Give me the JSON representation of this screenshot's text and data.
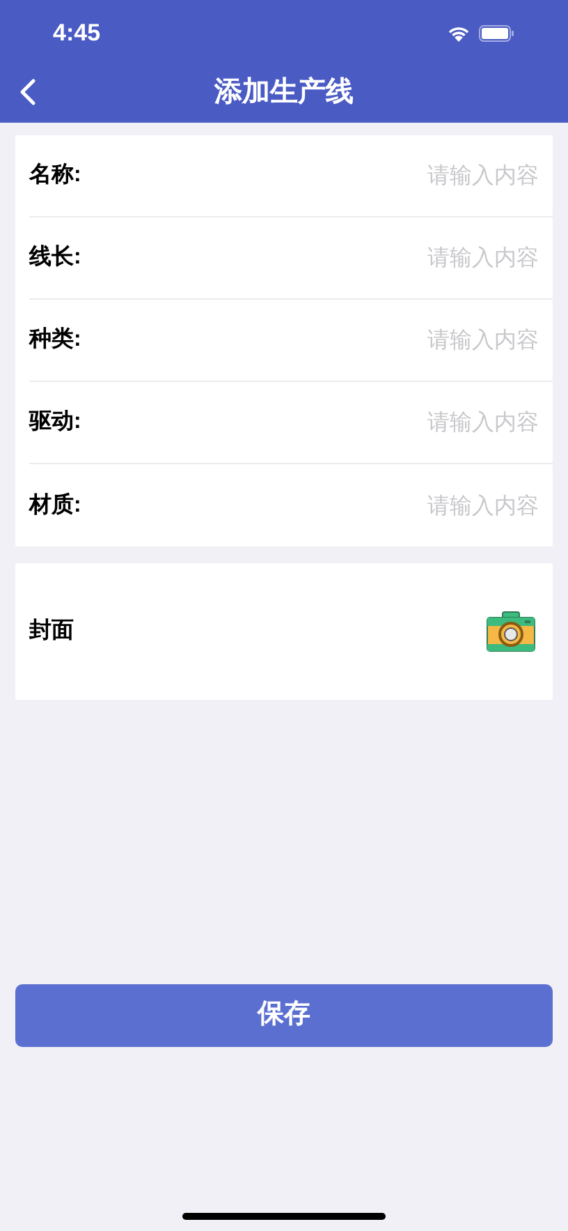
{
  "status_bar": {
    "time": "4:45"
  },
  "nav": {
    "title": "添加生产线"
  },
  "fields": [
    {
      "label": "名称:",
      "placeholder": "请输入内容"
    },
    {
      "label": "线长:",
      "placeholder": "请输入内容"
    },
    {
      "label": "种类:",
      "placeholder": "请输入内容"
    },
    {
      "label": "驱动:",
      "placeholder": "请输入内容"
    },
    {
      "label": "材质:",
      "placeholder": "请输入内容"
    }
  ],
  "cover": {
    "label": "封面"
  },
  "save_button": "保存"
}
